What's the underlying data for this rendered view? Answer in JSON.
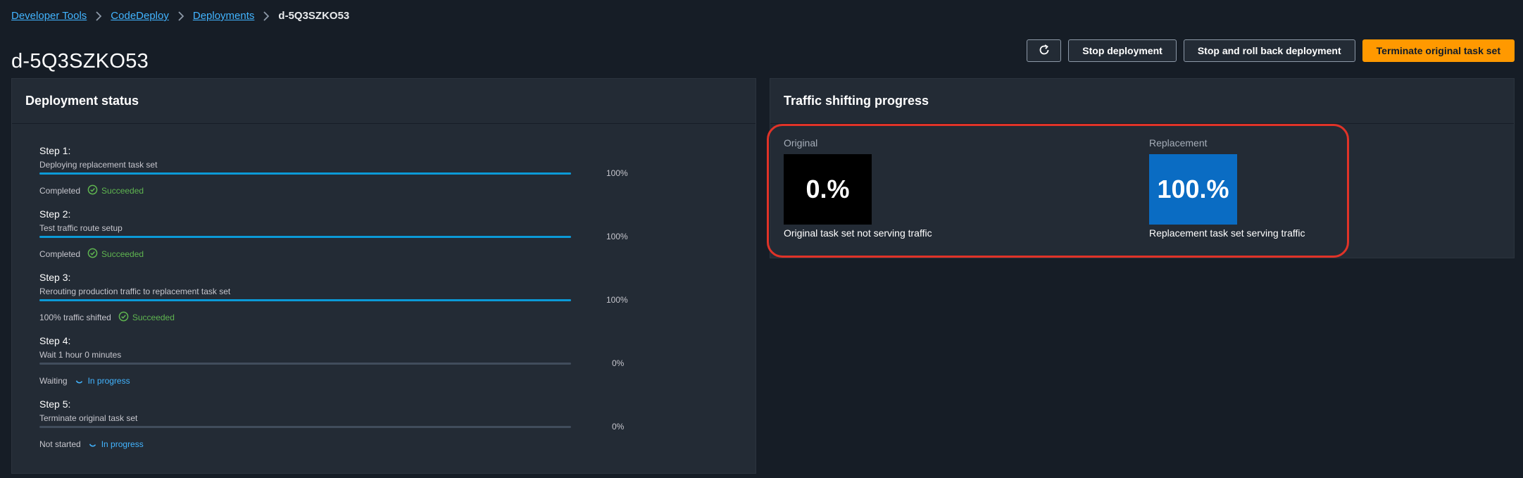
{
  "breadcrumb": {
    "items": [
      "Developer Tools",
      "CodeDeploy",
      "Deployments"
    ],
    "current": "d-5Q3SZKO53"
  },
  "page": {
    "title": "d-5Q3SZKO53"
  },
  "actions": {
    "refresh_icon": "refresh-icon",
    "stop": "Stop deployment",
    "stop_rollback": "Stop and roll back deployment",
    "terminate": "Terminate original task set"
  },
  "deployment_status": {
    "title": "Deployment status",
    "steps": [
      {
        "name": "Step 1:",
        "description": "Deploying replacement task set",
        "progress": 1.0,
        "percent": "100%",
        "status_label": "Completed",
        "status": "Succeeded",
        "status_kind": "success"
      },
      {
        "name": "Step 2:",
        "description": "Test traffic route setup",
        "progress": 1.0,
        "percent": "100%",
        "status_label": "Completed",
        "status": "Succeeded",
        "status_kind": "success"
      },
      {
        "name": "Step 3:",
        "description": "Rerouting production traffic to replacement task set",
        "progress": 1.0,
        "percent": "100%",
        "status_label": "100% traffic shifted",
        "status": "Succeeded",
        "status_kind": "success"
      },
      {
        "name": "Step 4:",
        "description": "Wait 1 hour 0 minutes",
        "progress": 0.0,
        "percent": "0%",
        "status_label": "Waiting",
        "status": "In progress",
        "status_kind": "in-progress"
      },
      {
        "name": "Step 5:",
        "description": "Terminate original task set",
        "progress": 0.0,
        "percent": "0%",
        "status_label": "Not started",
        "status": "In progress",
        "status_kind": "in-progress"
      }
    ]
  },
  "traffic": {
    "title": "Traffic shifting progress",
    "original": {
      "label": "Original",
      "value": "0.%",
      "note": "Original task set not serving traffic",
      "color": "#000000"
    },
    "replacement": {
      "label": "Replacement",
      "value": "100.%",
      "note": "Replacement task set serving traffic",
      "color": "#0a6cc3"
    }
  },
  "colors": {
    "accent": "#ff9900",
    "link": "#42b4ff",
    "progress": "#0b9ad7",
    "success": "#5fb550",
    "highlight": "#e03328"
  }
}
